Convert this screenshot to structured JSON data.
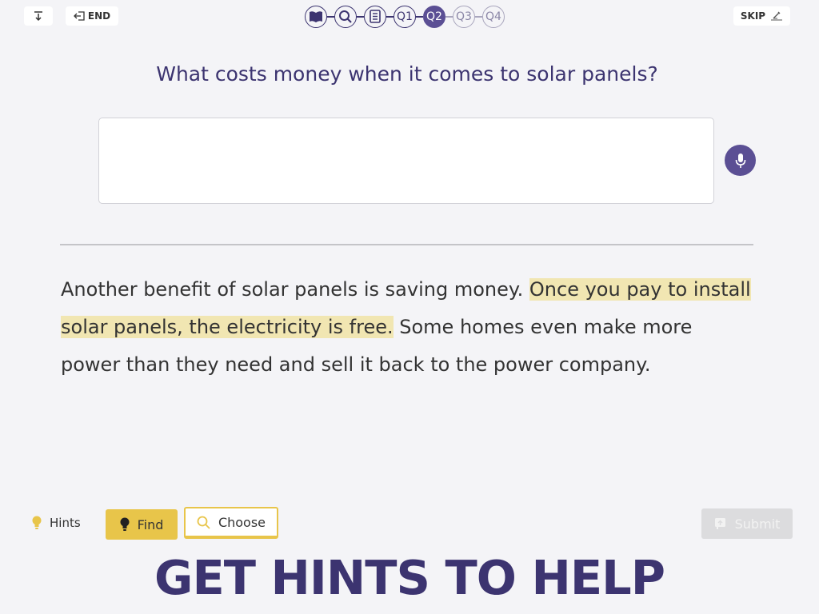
{
  "topbar": {
    "end_label": "END",
    "skip_label": "SKIP",
    "down_icon": "download-arrow-icon",
    "end_icon": "exit-icon",
    "skip_icon": "skip-pen-icon"
  },
  "progress": {
    "icon_steps": [
      "book-icon",
      "search-icon",
      "notes-icon"
    ],
    "steps": [
      "Q1",
      "Q2",
      "Q3",
      "Q4"
    ],
    "active": "Q2"
  },
  "question": "What costs money when it comes to solar panels?",
  "answer": {
    "value": "",
    "mic_icon": "microphone-icon"
  },
  "passage": {
    "before": "Another benefit of solar panels is saving money. ",
    "highlight": "Once you pay to install solar panels, the electricity is free.",
    "after": " Some homes even make more power than they need and sell it back to the power company."
  },
  "hints": {
    "label": "Hints",
    "find_label": "Find",
    "choose_label": "Choose",
    "submit_label": "Submit"
  },
  "banner": "GET HINTS TO HELP",
  "colors": {
    "accent": "#3c3470",
    "active_step": "#5b4f94",
    "hint_yellow": "#e8c54a",
    "highlight": "#f1e6b2"
  }
}
